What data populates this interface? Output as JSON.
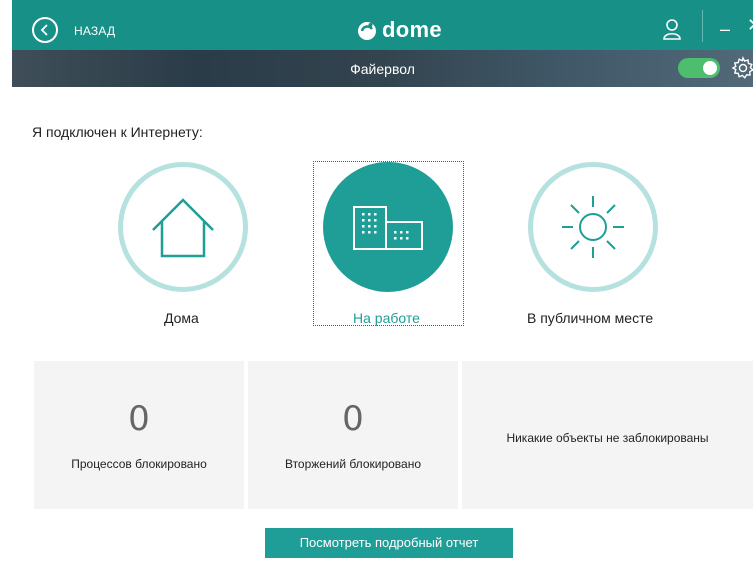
{
  "header": {
    "back_label": "НАЗАД",
    "logo_text": "dome",
    "icons": {
      "back": "back-arrow-icon",
      "user": "user-icon",
      "minimize": "minimize-icon",
      "close": "close-icon"
    }
  },
  "subbar": {
    "title": "Файервол",
    "toggle_on": true,
    "icons": {
      "settings": "gear-icon"
    }
  },
  "main": {
    "connect_label": "Я подключен к Интернету:",
    "options": [
      {
        "label": "Дома",
        "icon": "house-icon",
        "selected": false
      },
      {
        "label": "На работе",
        "icon": "office-buildings-icon",
        "selected": true
      },
      {
        "label": "В публичном месте",
        "icon": "sun-icon",
        "selected": false
      }
    ],
    "stats": [
      {
        "value": "0",
        "label": "Процессов блокировано"
      },
      {
        "value": "0",
        "label": "Вторжений блокировано"
      },
      {
        "label": "Никакие объекты не заблокированы"
      }
    ],
    "report_button": "Посмотреть подробный отчет"
  },
  "colors": {
    "accent": "#1e9e97",
    "accent_light": "#b5e1df",
    "toggle": "#4dbe6d",
    "subbar": "#2a3c48",
    "selected_text": "#1e9e97"
  }
}
